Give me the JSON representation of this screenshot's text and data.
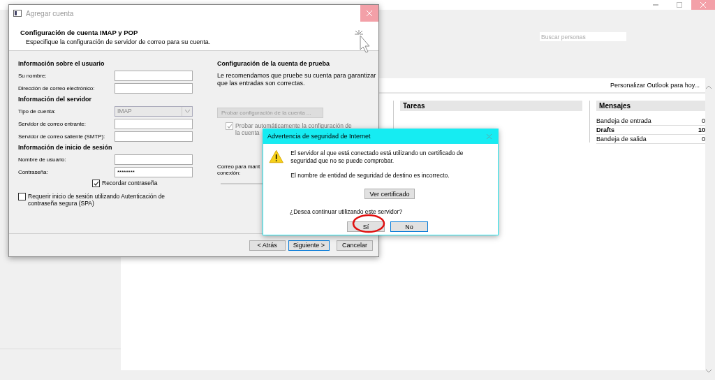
{
  "outlook": {
    "search": {
      "placeholder": "Buscar personas"
    },
    "customize_link": "Personalizar Outlook para hoy...",
    "tasks": {
      "title": "Tareas"
    },
    "messages": {
      "title": "Mensajes",
      "rows": [
        {
          "label": "Bandeja de entrada",
          "count": "0",
          "unread": false
        },
        {
          "label": "Drafts",
          "count": "10",
          "unread": true
        },
        {
          "label": "Bandeja de salida",
          "count": "0",
          "unread": false
        }
      ]
    }
  },
  "add_account": {
    "title": "Agregar cuenta",
    "heading": "Configuración de cuenta IMAP y POP",
    "subheading": "Especifique la configuración de servidor de correo para su cuenta.",
    "sections": [
      {
        "title": "Información sobre el usuario",
        "fields": [
          {
            "label": "Su nombre:",
            "kind": "text"
          },
          {
            "label": "Dirección de correo electrónico:",
            "kind": "text"
          }
        ]
      },
      {
        "title": "Información del servidor",
        "fields": [
          {
            "label": "Tipo de cuenta:",
            "value": "IMAP",
            "kind": "select",
            "disabled": true
          },
          {
            "label": "Servidor de correo entrante:",
            "kind": "text"
          },
          {
            "label": "Servidor de correo saliente (SMTP):",
            "kind": "text"
          }
        ]
      },
      {
        "title": "Información de inicio de sesión",
        "fields": [
          {
            "label": "Nombre de usuario:",
            "kind": "text"
          },
          {
            "label": "Contraseña:",
            "value": "********",
            "kind": "text"
          }
        ]
      }
    ],
    "remember": {
      "label": "Recordar contraseña",
      "checked": true
    },
    "spa": {
      "label": "Requerir inicio de sesión utilizando Autenticación de contraseña segura (SPA)",
      "checked": false
    },
    "test": {
      "title": "Configuración de la cuenta de prueba",
      "text": "Le recomendamos que pruebe su cuenta para garantizar que las entradas son correctas.",
      "button": "Probar configuración de la cuenta ...",
      "auto_lines": [
        "Probar automáticamente la configuración de",
        "la cuenta"
      ],
      "auto_checked": true,
      "offline_lines": [
        "Correo para mant",
        "conexión:"
      ]
    },
    "buttons": [
      {
        "label": "< Atrás",
        "default": false
      },
      {
        "label": "Siguiente >",
        "default": true
      },
      {
        "label": "Cancelar",
        "default": false
      }
    ]
  },
  "warning": {
    "title": "Advertencia de seguridad de Internet",
    "message": "El servidor al que está conectado está utilizando un certificado de seguridad que no se puede comprobar.",
    "detail": "El nombre de entidad de seguridad de destino es incorrecto.",
    "cert_button": "Ver certificado",
    "question": "¿Desea continuar utilizando este servidor?",
    "buttons": [
      {
        "label": "Sí",
        "default": false,
        "circled": true
      },
      {
        "label": "No",
        "default": true,
        "circled": false
      }
    ]
  }
}
